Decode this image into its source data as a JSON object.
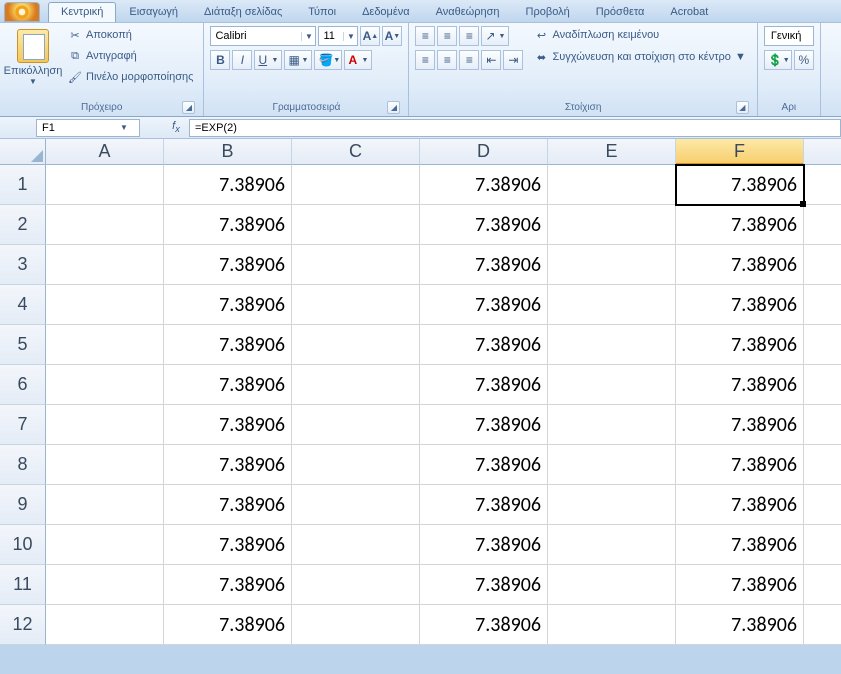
{
  "tabs": [
    "Κεντρική",
    "Εισαγωγή",
    "Διάταξη σελίδας",
    "Τύποι",
    "Δεδομένα",
    "Αναθεώρηση",
    "Προβολή",
    "Πρόσθετα",
    "Acrobat"
  ],
  "activeTabIndex": 0,
  "clipboard": {
    "paste": "Επικόλληση",
    "cut": "Αποκοπή",
    "copy": "Αντιγραφή",
    "formatPainter": "Πινέλο μορφοποίησης",
    "label": "Πρόχειρο"
  },
  "font": {
    "name": "Calibri",
    "size": "11",
    "label": "Γραμματοσειρά"
  },
  "alignment": {
    "wrap": "Αναδίπλωση κειμένου",
    "merge": "Συγχώνευση και στοίχιση στο κέντρο",
    "label": "Στοίχιση"
  },
  "number": {
    "format": "Γενική",
    "label": "Αρι"
  },
  "nameBox": "F1",
  "formula": "=EXP(2)",
  "columns": [
    "A",
    "B",
    "C",
    "D",
    "E",
    "F"
  ],
  "selectedColIndex": 5,
  "rowCount": 12,
  "cellValue": "7.38906",
  "filledColumns": [
    1,
    3,
    5
  ],
  "selectedCell": {
    "row": 0,
    "col": 5
  }
}
